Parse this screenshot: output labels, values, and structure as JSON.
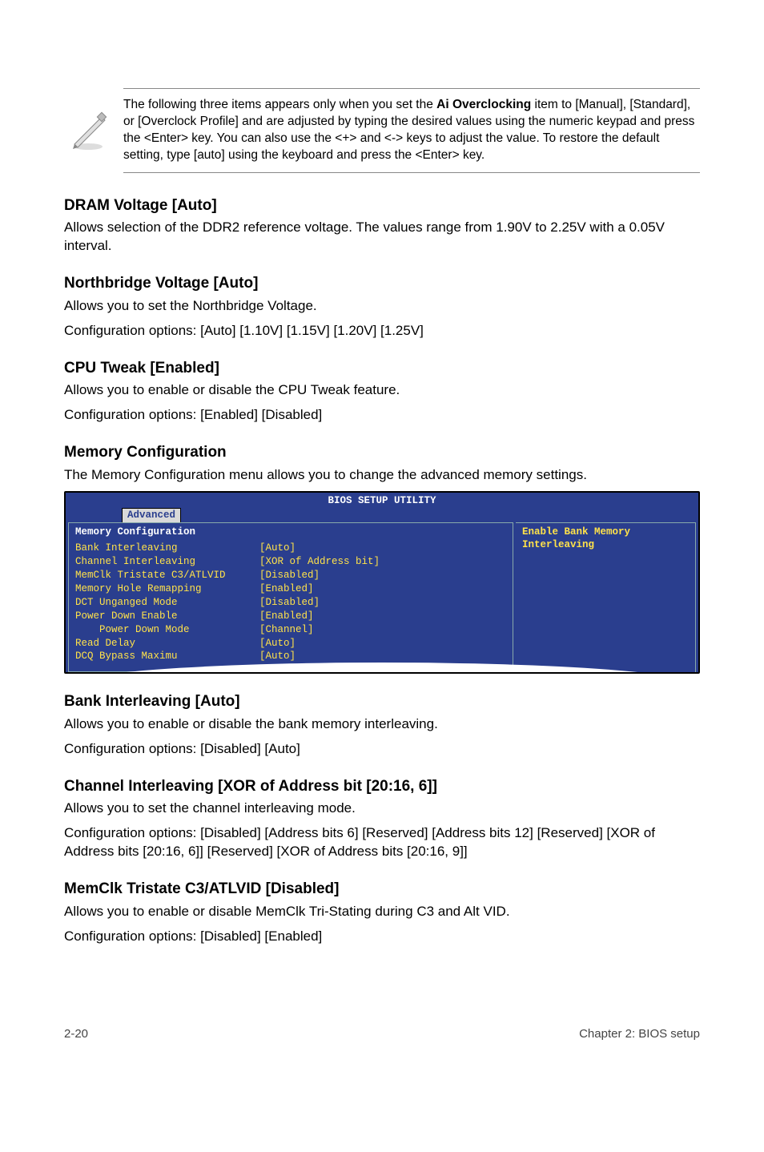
{
  "note": {
    "text_parts": {
      "p1": "The following three items appears only when you set the ",
      "bold": "Ai Overclocking",
      "p2": " item to [Manual], [Standard], or [Overclock Profile] and are adjusted by typing the desired values using the numeric keypad and press the <Enter> key. You can also use the <+> and <-> keys to adjust the value. To restore the default setting, type [auto] using the keyboard and press the <Enter> key."
    }
  },
  "sections": {
    "dram_voltage": {
      "heading": "DRAM Voltage [Auto]",
      "body": "Allows selection of the DDR2 reference voltage. The values range from 1.90V to 2.25V with a 0.05V interval."
    },
    "northbridge": {
      "heading": "Northbridge Voltage [Auto]",
      "body1": "Allows you to set the Northbridge Voltage.",
      "body2": "Configuration options: [Auto] [1.10V] [1.15V] [1.20V] [1.25V]"
    },
    "cpu_tweak": {
      "heading": "CPU Tweak [Enabled]",
      "body1": "Allows you to enable or disable the CPU Tweak feature.",
      "body2": "Configuration options: [Enabled] [Disabled]"
    },
    "mem_config": {
      "heading": "Memory Configuration",
      "body": "The Memory Configuration menu allows you to change the advanced memory settings."
    },
    "bank_interleaving": {
      "heading": "Bank Interleaving [Auto]",
      "body1": "Allows you to enable or disable the bank memory interleaving.",
      "body2": "Configuration options: [Disabled] [Auto]"
    },
    "channel_interleaving": {
      "heading": "Channel Interleaving [XOR of Address bit [20:16, 6]]",
      "body1": "Allows you to set the channel interleaving mode.",
      "body2": "Configuration options: [Disabled] [Address bits 6] [Reserved] [Address bits 12] [Reserved] [XOR of Address bits [20:16, 6]] [Reserved] [XOR of Address bits [20:16, 9]]"
    },
    "memclk": {
      "heading": "MemClk Tristate C3/ATLVID [Disabled]",
      "body1": "Allows you to enable or disable MemClk Tri-Stating during C3 and Alt VID.",
      "body2": "Configuration options: [Disabled] [Enabled]"
    }
  },
  "bios": {
    "title": "BIOS SETUP UTILITY",
    "tab": "Advanced",
    "panel_heading": "Memory Configuration",
    "help": "Enable Bank Memory Interleaving",
    "rows": [
      {
        "k": "Bank Interleaving",
        "v": "[Auto]",
        "sub": false
      },
      {
        "k": "Channel Interleaving",
        "v": "[XOR of Address bit]",
        "sub": false
      },
      {
        "k": "MemClk Tristate C3/ATLVID",
        "v": "[Disabled]",
        "sub": false
      },
      {
        "k": "Memory Hole Remapping",
        "v": "[Enabled]",
        "sub": false
      },
      {
        "k": "DCT Unganged Mode",
        "v": "[Disabled]",
        "sub": false
      },
      {
        "k": "Power Down Enable",
        "v": "[Enabled]",
        "sub": false
      },
      {
        "k": "Power Down Mode",
        "v": "[Channel]",
        "sub": true
      },
      {
        "k": "Read Delay",
        "v": "[Auto]",
        "sub": false
      },
      {
        "k": "DCQ Bypass Maximu",
        "v": "[Auto]",
        "sub": false
      }
    ]
  },
  "footer": {
    "left": "2-20",
    "right": "Chapter 2: BIOS setup"
  }
}
